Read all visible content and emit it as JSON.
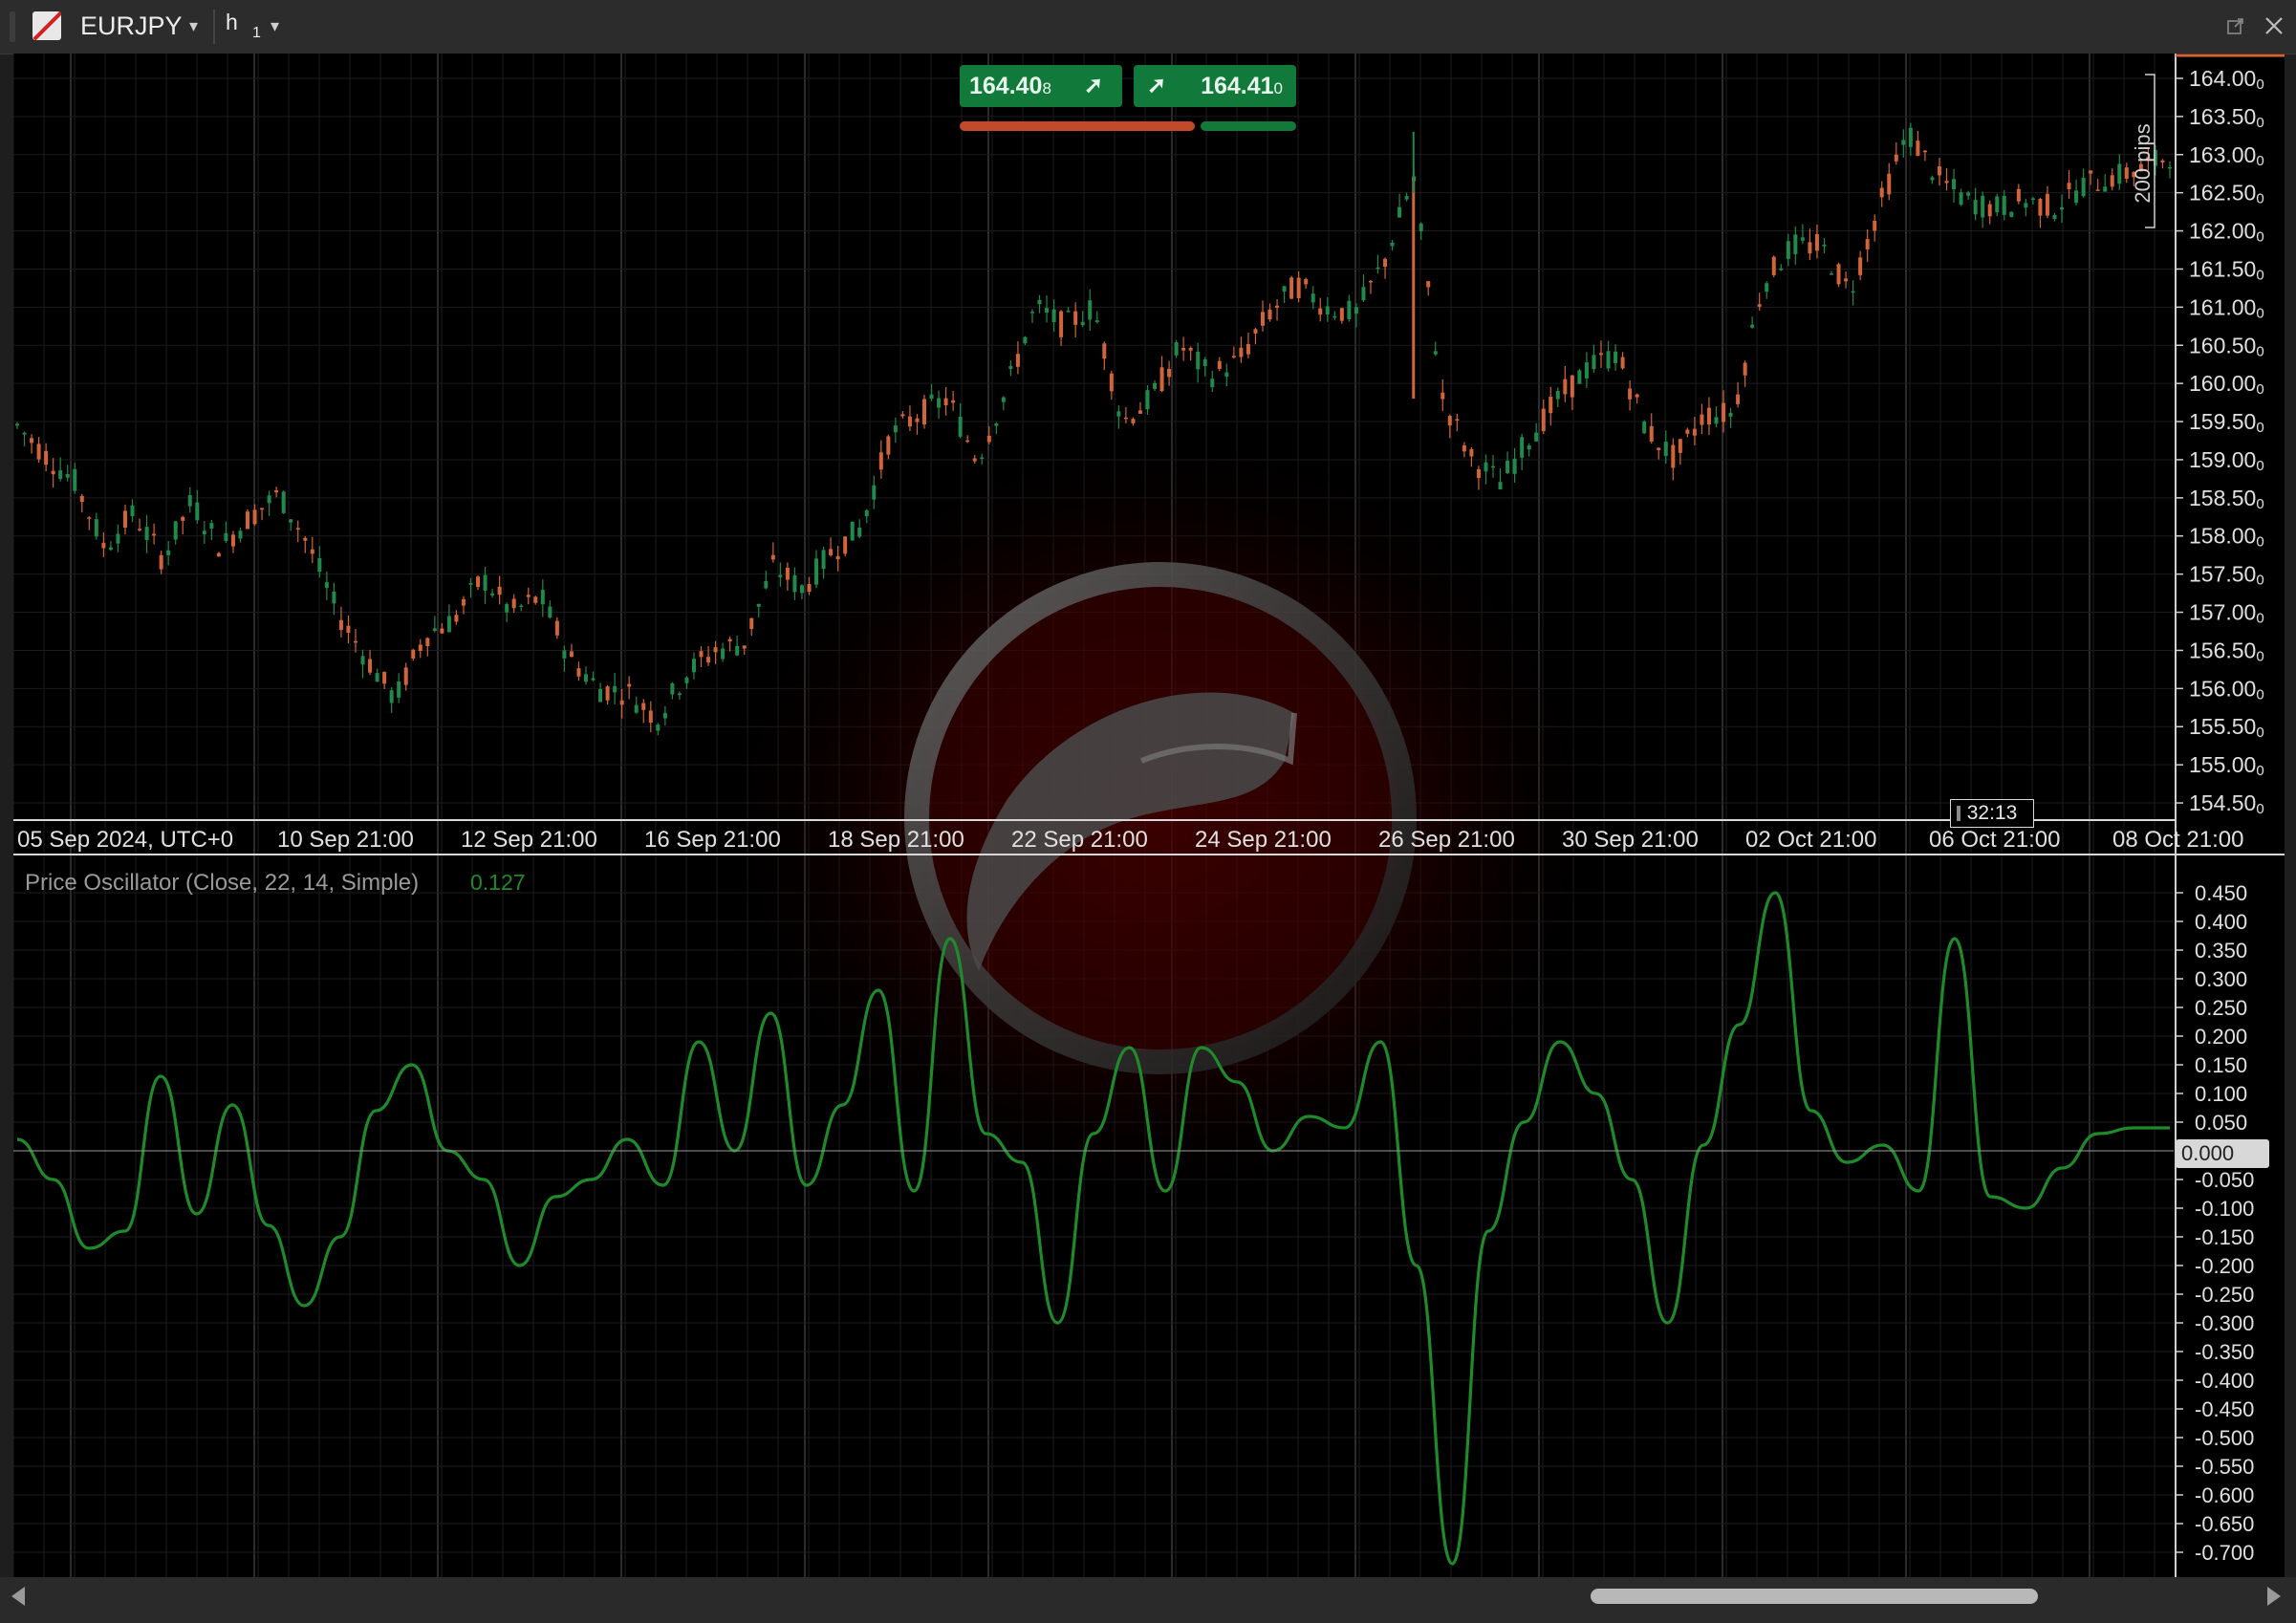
{
  "window": {
    "symbol": "EURJPY",
    "timeframe": "h",
    "timeframe_sub": "1",
    "dropdown_glyph": "▾"
  },
  "quotes": {
    "bid": {
      "main": "164.40",
      "small": "8"
    },
    "ask": {
      "main": "164.41",
      "small": "0"
    },
    "bid_color": "#c2492a",
    "ask_color": "#117a3a"
  },
  "price_axis": {
    "labels": [
      "164.00",
      "163.50",
      "163.00",
      "162.50",
      "162.00",
      "161.50",
      "161.00",
      "160.50",
      "160.00",
      "159.50",
      "159.00",
      "158.50",
      "158.00",
      "157.50",
      "157.00",
      "156.50",
      "156.00",
      "155.50",
      "155.00",
      "154.50"
    ],
    "subscript": "0"
  },
  "time_axis": {
    "labels": [
      "05 Sep 2024, UTC+0",
      "10 Sep 21:00",
      "12 Sep 21:00",
      "16 Sep 21:00",
      "18 Sep 21:00",
      "22 Sep 21:00",
      "24 Sep 21:00",
      "26 Sep 21:00",
      "30 Sep 21:00",
      "02 Oct 21:00",
      "06 Oct 21:00",
      "08 Oct 21:00"
    ]
  },
  "pips_label": "200 pips",
  "candle_timer": "32:13",
  "oscillator": {
    "title": "Price Oscillator (Close, 22, 14, Simple)",
    "current_value": "0.127",
    "axis_labels": [
      "0.450",
      "0.400",
      "0.350",
      "0.300",
      "0.250",
      "0.200",
      "0.150",
      "0.100",
      "0.050",
      "0.000",
      "-0.050",
      "-0.100",
      "-0.150",
      "-0.200",
      "-0.250",
      "-0.300",
      "-0.350",
      "-0.400",
      "-0.450",
      "-0.500",
      "-0.550",
      "-0.600",
      "-0.650",
      "-0.700"
    ],
    "zero_label": "0.000",
    "line_color": "#1f8a2a"
  },
  "colors": {
    "bull_candle": "#1f8a4c",
    "bear_candle": "#d2643a",
    "background": "#000000"
  },
  "chart_data": {
    "type": "line",
    "price_series": {
      "name": "EURJPY",
      "x_index": [
        0,
        4,
        8,
        12,
        16,
        20,
        24,
        28,
        32,
        36,
        40,
        44,
        48,
        52,
        56,
        60,
        64,
        68,
        72,
        76,
        80,
        84,
        88,
        92,
        96,
        100,
        104,
        108,
        112,
        116,
        120,
        124,
        128,
        132,
        136,
        140,
        144,
        148,
        152,
        156,
        160,
        164,
        168,
        172,
        176,
        180,
        184,
        188,
        192,
        196,
        200,
        204,
        208,
        212,
        216,
        220,
        224,
        228,
        232,
        236,
        240,
        244,
        248,
        252,
        256,
        260,
        264,
        268,
        272,
        276,
        280,
        284,
        288,
        292,
        296
      ],
      "close": [
        159.45,
        159.05,
        158.7,
        157.85,
        158.3,
        157.7,
        158.45,
        157.85,
        158.25,
        158.55,
        157.9,
        157.0,
        156.4,
        155.85,
        156.7,
        156.9,
        157.45,
        157.0,
        157.2,
        156.4,
        156.0,
        155.95,
        155.6,
        156.2,
        156.5,
        156.6,
        157.6,
        157.3,
        157.8,
        158.1,
        159.3,
        159.6,
        159.8,
        159.0,
        159.9,
        161.0,
        160.75,
        161.0,
        159.5,
        159.8,
        160.5,
        160.1,
        160.3,
        160.9,
        161.3,
        161.0,
        160.9,
        161.6,
        162.7,
        159.8,
        159.0,
        158.7,
        159.3,
        159.8,
        160.2,
        160.4,
        159.4,
        159.0,
        159.6,
        159.6,
        161.3,
        161.8,
        161.8,
        161.2,
        162.3,
        163.3,
        162.7,
        162.4,
        162.3,
        162.4,
        162.3,
        162.6,
        162.7,
        162.8,
        163.0
      ]
    },
    "oscillator_series": {
      "name": "Price Oscillator (Close, 22, 14, Simple)",
      "x_index": [
        0,
        4,
        8,
        12,
        16,
        20,
        24,
        28,
        32,
        36,
        40,
        44,
        48,
        52,
        56,
        60,
        64,
        68,
        72,
        76,
        80,
        84,
        88,
        92,
        96,
        100,
        104,
        108,
        112,
        116,
        120,
        124,
        128,
        132,
        136,
        140,
        144,
        148,
        152,
        156,
        160,
        164,
        168,
        172,
        176,
        180,
        184,
        188,
        192,
        196,
        200,
        204,
        208,
        212,
        216,
        220,
        224,
        228,
        232,
        236,
        240,
        244,
        248,
        252,
        256,
        260,
        264,
        268,
        272,
        276,
        280,
        284,
        288,
        292,
        296
      ],
      "values": [
        0.02,
        -0.05,
        -0.17,
        -0.14,
        0.13,
        -0.11,
        0.08,
        -0.13,
        -0.27,
        -0.15,
        0.07,
        0.15,
        0.0,
        -0.05,
        -0.2,
        -0.08,
        -0.05,
        0.02,
        -0.06,
        0.19,
        0.0,
        0.24,
        -0.06,
        0.08,
        0.28,
        -0.07,
        0.37,
        0.03,
        -0.02,
        -0.3,
        0.03,
        0.18,
        -0.07,
        0.18,
        0.12,
        0.0,
        0.06,
        0.04,
        0.19,
        -0.2,
        -0.72,
        -0.14,
        0.05,
        0.19,
        0.1,
        -0.05,
        -0.3,
        0.01,
        0.22,
        0.45,
        0.07,
        -0.02,
        0.01,
        -0.07,
        0.37,
        -0.08,
        -0.1,
        -0.03,
        0.03,
        0.04,
        0.04
      ],
      "zero_line": 0.0
    },
    "ylim_price": [
      154.3,
      164.2
    ],
    "ylim_oscillator": [
      -0.72,
      0.47
    ],
    "grid": true
  }
}
